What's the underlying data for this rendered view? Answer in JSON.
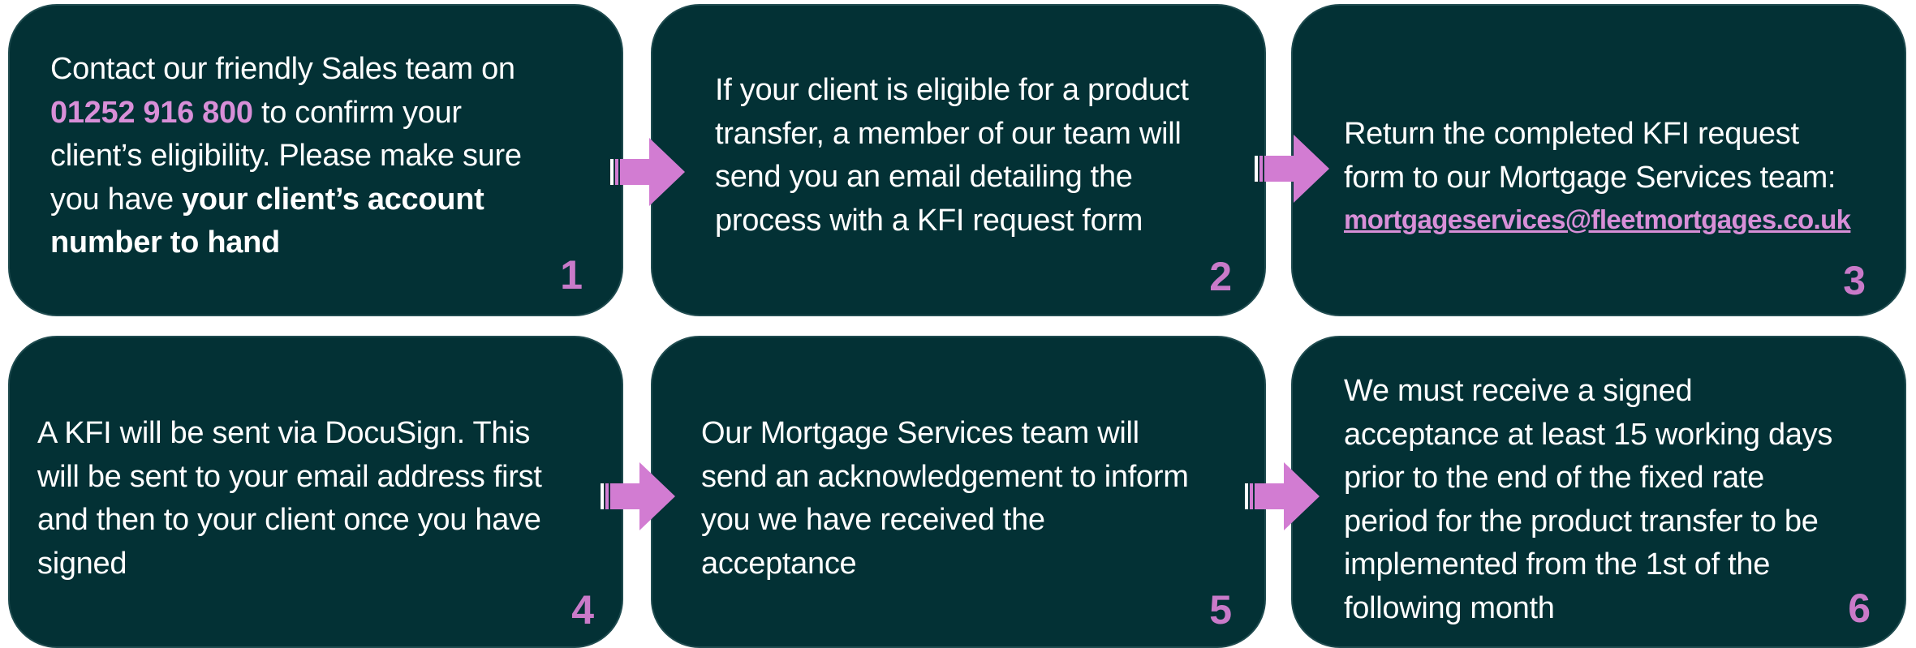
{
  "colors": {
    "card_background": "#033135",
    "card_border": "#1f4b4f",
    "accent": "#c97ac9",
    "text": "#ffffff"
  },
  "steps": [
    {
      "number": "1",
      "lines": [
        "Contact our friendly Sales team on",
        "to confirm your",
        "client’s eligibility. Please make sure",
        "you have ",
        "your client’s account",
        "number to hand"
      ],
      "phone": "01252 916 800"
    },
    {
      "number": "2",
      "lines": [
        "If your client is eligible for a product",
        "transfer, a member of our team will",
        "send you an email detailing the",
        "process with a KFI request form"
      ]
    },
    {
      "number": "3",
      "lines": [
        "Return the completed KFI request",
        "form to our Mortgage Services team:"
      ],
      "email": "mortgageservices@fleetmortgages.co.uk"
    },
    {
      "number": "4",
      "lines": [
        "A KFI will be sent via DocuSign. This",
        "will be sent to your email address first",
        "and then to your client once you have",
        "signed"
      ]
    },
    {
      "number": "5",
      "lines": [
        "Our Mortgage Services team will",
        "send an acknowledgement to inform",
        "you we have received the",
        "acceptance"
      ]
    },
    {
      "number": "6",
      "lines": [
        "We must receive a signed",
        "acceptance at least 15 working days",
        "prior to the end of the fixed rate",
        "period for the product transfer to be",
        "implemented from the 1st of the",
        "following month"
      ]
    }
  ],
  "arrow_icon": "right-arrow-icon"
}
